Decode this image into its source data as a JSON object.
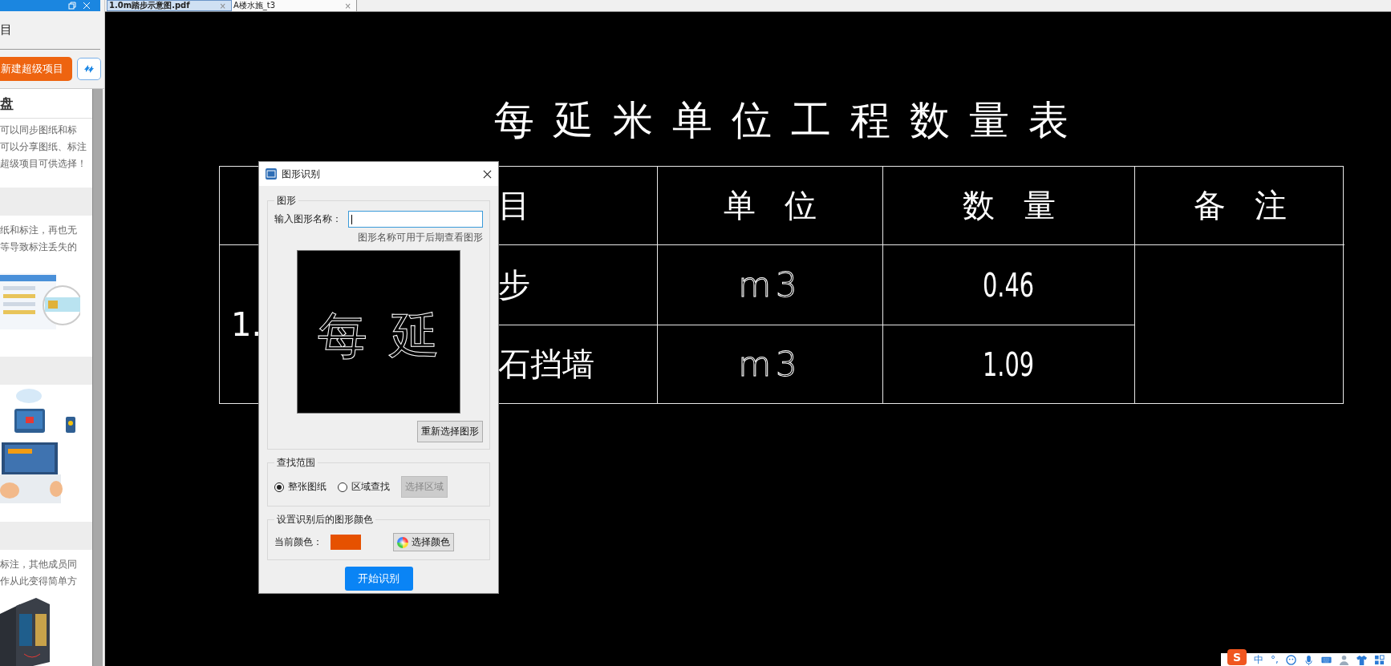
{
  "left_panel": {
    "heading": "目",
    "new_button": "新建超级项目",
    "sections": [
      {
        "kind": "titled",
        "title": "盘",
        "lines": [
          "可以同步图纸和标",
          "可以分享图纸、标注",
          "超级项目可供选择！"
        ]
      },
      {
        "kind": "band",
        "lines": [
          "纸和标注，再也无",
          "等导致标注丢失的"
        ],
        "picture": {
          "kind": "picture"
        }
      },
      {
        "kind": "band",
        "picture": {
          "kind": "picture"
        }
      },
      {
        "kind": "band",
        "lines": [
          "标注，其他成员同",
          "作从此变得简单方"
        ],
        "picture": {
          "kind": "picture"
        }
      }
    ]
  },
  "tabs": [
    {
      "label": "1.0m踏步示意图.pdf",
      "selected": true,
      "close": "×"
    },
    {
      "label": "A楼水施_t3",
      "selected": false,
      "close": "×"
    }
  ],
  "drawing": {
    "title": "每延米单位工程数量表",
    "table": {
      "header": [
        "目",
        "单位",
        "数量",
        "备注"
      ],
      "number": "1.",
      "rows": [
        {
          "name": "步",
          "unit": "m3",
          "quantity": "0.46"
        },
        {
          "name": "石挡墙",
          "unit": "m3",
          "quantity": "1.09"
        }
      ]
    }
  },
  "dialog": {
    "title": "图形识别",
    "shape_group": {
      "legend": "图形",
      "name_label": "输入图形名称：",
      "hint": "图形名称可用于后期查看图形",
      "preview": [
        "每",
        "延"
      ],
      "reselect_button": "重新选择图形"
    },
    "range_group": {
      "legend": "查找范围",
      "options": [
        {
          "label": "整张图纸",
          "selected": true
        },
        {
          "label": "区域查找",
          "selected": false
        }
      ],
      "select_area_button": {
        "label": "选择区域",
        "disabled": true
      }
    },
    "color_group": {
      "legend": "设置识别后的图形颜色",
      "current_label": "当前颜色：",
      "color": "#e65100",
      "pick_button": "选择颜色"
    },
    "start_button": "开始识别"
  },
  "ime_toolbar": {
    "logo": "S",
    "items": [
      "中",
      "°,"
    ]
  }
}
